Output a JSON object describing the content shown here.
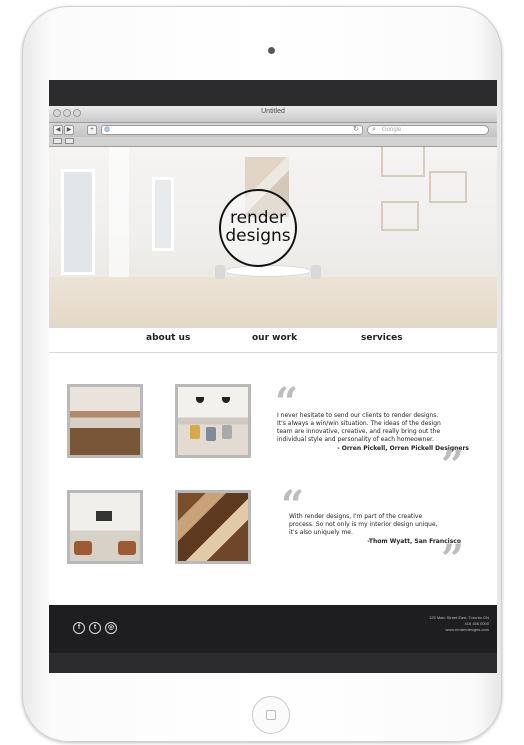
{
  "browser": {
    "window_title": "Untitled",
    "back_label": "◀",
    "forward_label": "▶",
    "plus_label": "+",
    "search_placeholder": "Google"
  },
  "hero": {
    "logo_line1": "render",
    "logo_line2": "designs"
  },
  "nav": {
    "items": [
      {
        "label": "about us"
      },
      {
        "label": "our work"
      },
      {
        "label": "services"
      }
    ]
  },
  "testimonials": [
    {
      "lines": [
        "I never hesitate to send our clients to render designs.",
        "It's always a win/win situation. The ideas of the design",
        "team are innovative, creative, and really bring out the",
        "individual style and personality of each homeowner."
      ],
      "author": "- Orren Pickell, Orren Pickell Designers"
    },
    {
      "lines": [
        "With render designs, I'm part of the creative",
        "process. So not only is my interior design unique,",
        "it's also uniquely me."
      ],
      "author": "-Thom Wyatt, San Francisco"
    }
  ],
  "footer": {
    "address": "125 Main Street East, Toronto ON",
    "phone": "416 456 0000",
    "website": "www.renderdesigns.com"
  },
  "icons": {
    "social": [
      "facebook-icon",
      "twitter-icon",
      "instagram-icon"
    ]
  },
  "colors": {
    "footer_bg": "#1e1e20",
    "thumb_frame": "#b9b9b9",
    "quote_mark": "#bdbdbd"
  }
}
